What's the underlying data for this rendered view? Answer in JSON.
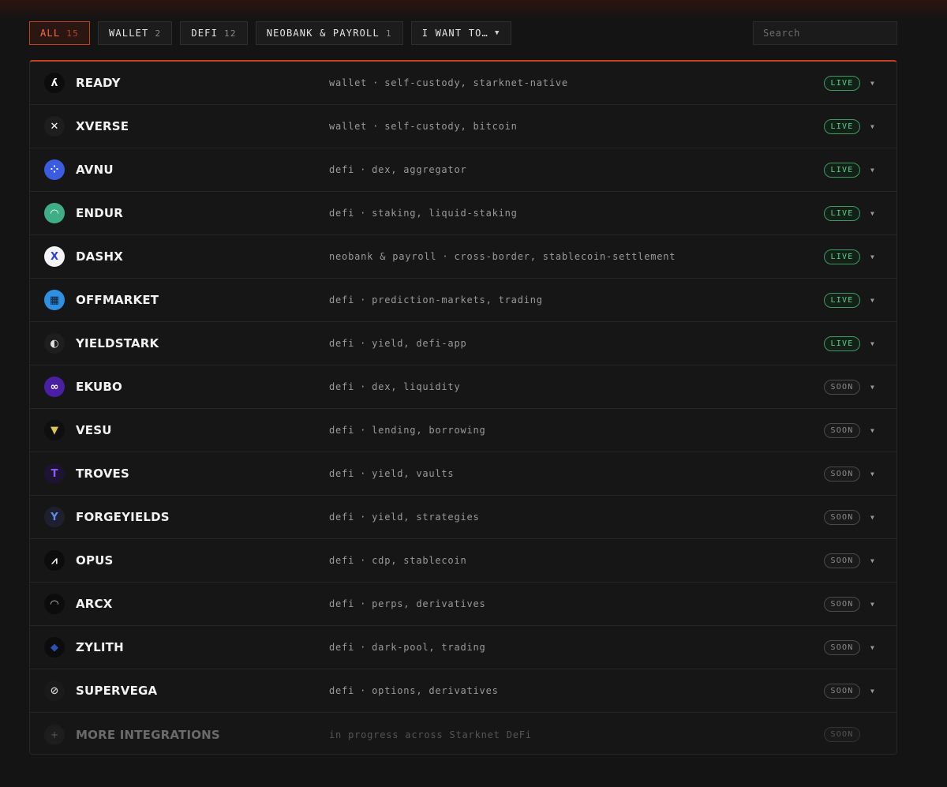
{
  "filters": [
    {
      "label": "ALL",
      "count": "15",
      "active": true
    },
    {
      "label": "WALLET",
      "count": "2",
      "active": false
    },
    {
      "label": "DEFI",
      "count": "12",
      "active": false
    },
    {
      "label": "NEOBANK & PAYROLL",
      "count": "1",
      "active": false
    }
  ],
  "intent_dropdown": {
    "label": "I WANT TO…",
    "icon": "caret-down-icon"
  },
  "search": {
    "placeholder": "Search",
    "value": ""
  },
  "colors": {
    "accent": "#c2421f",
    "live": "#5fd08a",
    "soon": "#8c8c8c",
    "background": "#141414"
  },
  "integrations": [
    {
      "name": "READY",
      "category": "wallet",
      "tags": "self-custody, starknet-native",
      "status": "LIVE",
      "icon": "ready-logo-icon",
      "logo_bg": "#0c0c0c",
      "logo_fg": "#ffffff",
      "logo_glyph": "ʎ"
    },
    {
      "name": "XVERSE",
      "category": "wallet",
      "tags": "self-custody, bitcoin",
      "status": "LIVE",
      "icon": "xverse-logo-icon",
      "logo_bg": "#1e1e1e",
      "logo_fg": "#ffffff",
      "logo_glyph": "✕"
    },
    {
      "name": "AVNU",
      "category": "defi",
      "tags": "dex, aggregator",
      "status": "LIVE",
      "icon": "avnu-logo-icon",
      "logo_bg": "#3b5ce0",
      "logo_fg": "#ffffff",
      "logo_glyph": "⁘"
    },
    {
      "name": "ENDUR",
      "category": "defi",
      "tags": "staking, liquid-staking",
      "status": "LIVE",
      "icon": "endur-logo-icon",
      "logo_bg": "#3fae87",
      "logo_fg": "#ffffff",
      "logo_glyph": "◠"
    },
    {
      "name": "DASHX",
      "category": "neobank & payroll",
      "tags": "cross-border, stablecoin-settlement",
      "status": "LIVE",
      "icon": "dashx-logo-icon",
      "logo_bg": "#f4f4f8",
      "logo_fg": "#2a3ed6",
      "logo_glyph": "X"
    },
    {
      "name": "OFFMARKET",
      "category": "defi",
      "tags": "prediction-markets, trading",
      "status": "LIVE",
      "icon": "offmarket-logo-icon",
      "logo_bg": "#2f8fe0",
      "logo_fg": "#0b1a2e",
      "logo_glyph": "▦"
    },
    {
      "name": "YIELDSTARK",
      "category": "defi",
      "tags": "yield, defi-app",
      "status": "LIVE",
      "icon": "yieldstark-logo-icon",
      "logo_bg": "#1e1e1e",
      "logo_fg": "#e0e0e0",
      "logo_glyph": "◐"
    },
    {
      "name": "EKUBO",
      "category": "defi",
      "tags": "dex, liquidity",
      "status": "SOON",
      "icon": "ekubo-logo-icon",
      "logo_bg": "#4b1fa3",
      "logo_fg": "#ffffff",
      "logo_glyph": "∞"
    },
    {
      "name": "VESU",
      "category": "defi",
      "tags": "lending, borrowing",
      "status": "SOON",
      "icon": "vesu-logo-icon",
      "logo_bg": "#0f0f0f",
      "logo_fg": "#d8c25a",
      "logo_glyph": "▼"
    },
    {
      "name": "TROVES",
      "category": "defi",
      "tags": "yield, vaults",
      "status": "SOON",
      "icon": "troves-logo-icon",
      "logo_bg": "#1c1430",
      "logo_fg": "#8a5cf0",
      "logo_glyph": "T"
    },
    {
      "name": "FORGEYIELDS",
      "category": "defi",
      "tags": "yield, strategies",
      "status": "SOON",
      "icon": "forgeyields-logo-icon",
      "logo_bg": "#1e2030",
      "logo_fg": "#5b8cf5",
      "logo_glyph": "Y"
    },
    {
      "name": "OPUS",
      "category": "defi",
      "tags": "cdp, stablecoin",
      "status": "SOON",
      "icon": "opus-logo-icon",
      "logo_bg": "#0c0c0c",
      "logo_fg": "#ffffff",
      "logo_glyph": "⩘"
    },
    {
      "name": "ARCX",
      "category": "defi",
      "tags": "perps, derivatives",
      "status": "SOON",
      "icon": "arcx-logo-icon",
      "logo_bg": "#0c0c0c",
      "logo_fg": "#cfcfcf",
      "logo_glyph": "◠"
    },
    {
      "name": "ZYLITH",
      "category": "defi",
      "tags": "dark-pool, trading",
      "status": "SOON",
      "icon": "zylith-logo-icon",
      "logo_bg": "#0c0c0c",
      "logo_fg": "#2c4fb8",
      "logo_glyph": "◆"
    },
    {
      "name": "SUPERVEGA",
      "category": "defi",
      "tags": "options, derivatives",
      "status": "SOON",
      "icon": "supervega-logo-icon",
      "logo_bg": "#1a1a1a",
      "logo_fg": "#cfcfcf",
      "logo_glyph": "⊘"
    }
  ],
  "more_integrations": {
    "name": "MORE INTEGRATIONS",
    "desc": "in progress across Starknet DeFi",
    "status": "SOON",
    "icon": "plus-icon",
    "glyph": "+"
  },
  "separator": "·"
}
